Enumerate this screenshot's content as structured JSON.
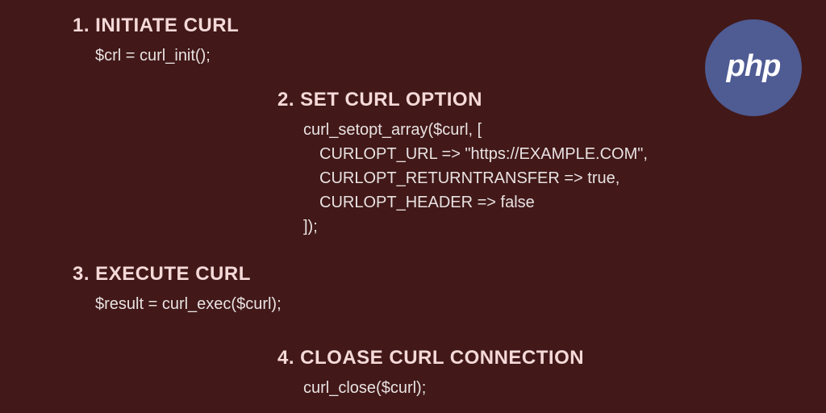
{
  "logo": {
    "text": "php"
  },
  "sections": {
    "s1": {
      "heading": "1. INITIATE CURL",
      "code": [
        "$crl = curl_init();"
      ]
    },
    "s2": {
      "heading": "2. SET CURL OPTION",
      "code": [
        "curl_setopt_array($curl, [",
        "CURLOPT_URL => \"https://EXAMPLE.COM\",",
        "CURLOPT_RETURNTRANSFER => true,",
        "CURLOPT_HEADER => false",
        "]);"
      ]
    },
    "s3": {
      "heading": "3. EXECUTE CURL",
      "code": [
        "$result = curl_exec($curl);"
      ]
    },
    "s4": {
      "heading": "4. CLOASE CURL CONNECTION",
      "code": [
        "curl_close($curl);"
      ]
    }
  }
}
